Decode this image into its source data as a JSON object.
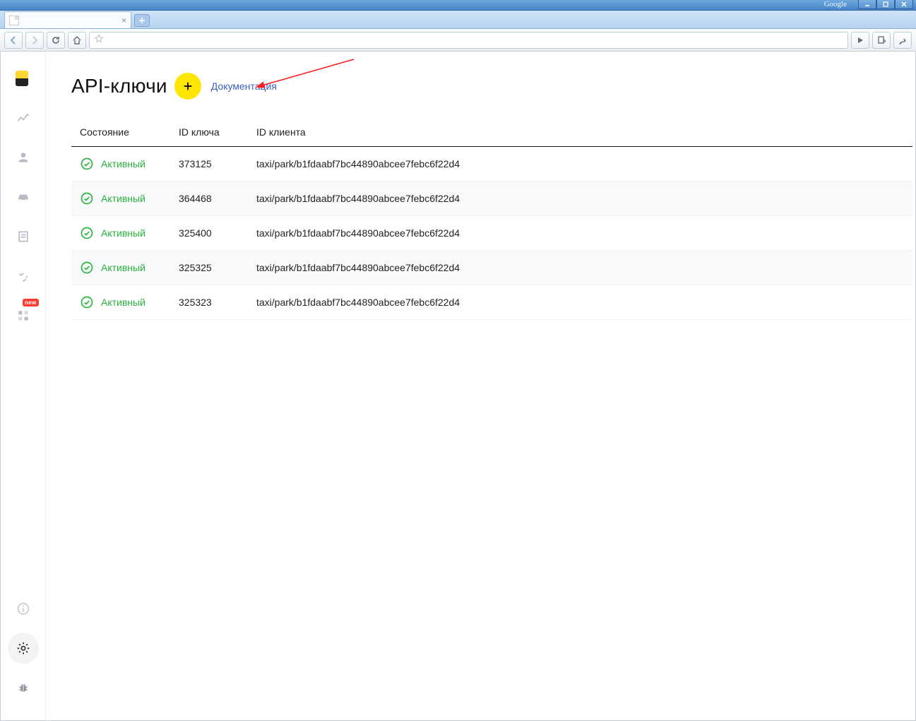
{
  "browser": {
    "google_label": "Google",
    "tab_title": "",
    "url": ""
  },
  "page": {
    "title": "API-ключи",
    "doc_link": "Документация"
  },
  "sidebar": {
    "badge": "new"
  },
  "table": {
    "headers": {
      "state": "Состояние",
      "key_id": "ID ключа",
      "client_id": "ID клиента"
    },
    "rows": [
      {
        "status": "Активный",
        "key_id": "373125",
        "client_id": "taxi/park/b1fdaabf7bc44890abcee7febc6f22d4"
      },
      {
        "status": "Активный",
        "key_id": "364468",
        "client_id": "taxi/park/b1fdaabf7bc44890abcee7febc6f22d4"
      },
      {
        "status": "Активный",
        "key_id": "325400",
        "client_id": "taxi/park/b1fdaabf7bc44890abcee7febc6f22d4"
      },
      {
        "status": "Активный",
        "key_id": "325325",
        "client_id": "taxi/park/b1fdaabf7bc44890abcee7febc6f22d4"
      },
      {
        "status": "Активный",
        "key_id": "325323",
        "client_id": "taxi/park/b1fdaabf7bc44890abcee7febc6f22d4"
      }
    ]
  }
}
